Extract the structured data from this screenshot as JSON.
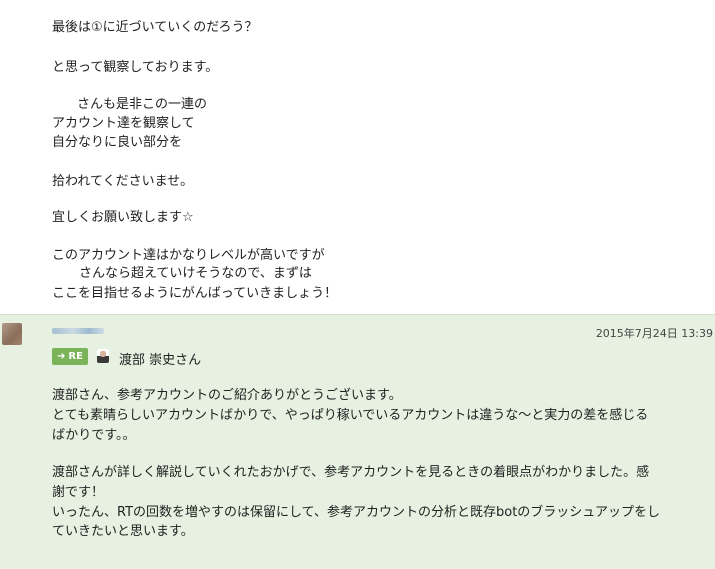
{
  "post": {
    "lines": [
      "最後は①に近づいていくのだろう？",
      "と思って観察しております。",
      "さんも是非この一連の",
      "アカウント達を観察して",
      "自分なりに良い部分を",
      "拾われてくださいませ。",
      "宜しくお願い致します☆",
      "このアカウント達はかなりレベルが高いですが",
      "さんなら超えていけそうなので、まずは",
      "ここを目指せるようにがんばっていきましょう！"
    ]
  },
  "reply": {
    "date": "2015年7月24日 13:39",
    "badge": "RE",
    "reply_to": "渡部 崇史さん",
    "lines": [
      "渡部さん、参考アカウントのご紹介ありがとうございます。",
      "とても素晴らしいアカウントばかりで、やっぱり稼いでいるアカウントは違うな～と実力の差を感じる",
      "ばかりです。。",
      "渡部さんが詳しく解説していくれたおかげで、参考アカウントを見るときの着眼点がわかりました。感",
      "謝です！",
      "いったん、RTの回数を増やすのは保留にして、参考アカウントの分析と既存botのブラッシュアップをし",
      "ていきたいと思います。"
    ]
  }
}
